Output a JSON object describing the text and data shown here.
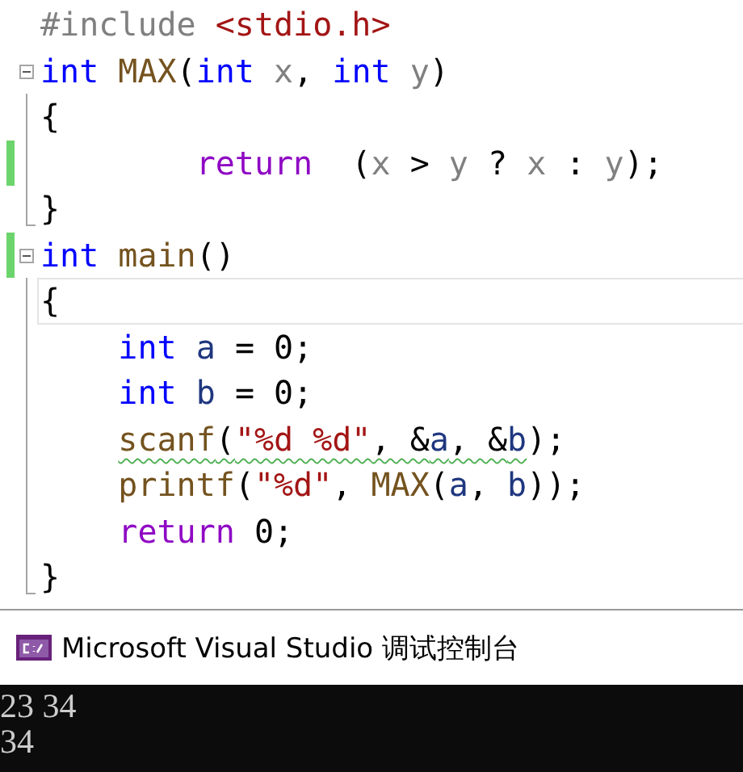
{
  "editor": {
    "lines": [
      {
        "kind": "plain",
        "changed": false,
        "current": false,
        "tokens": [
          {
            "kind": "preproc",
            "text": "#include"
          },
          {
            "kind": "string",
            "text": " <stdio.h>"
          }
        ]
      },
      {
        "kind": "fold-start",
        "changed": false,
        "current": false,
        "tokens": [
          {
            "kind": "keyword",
            "text": "int"
          },
          {
            "kind": "func",
            "text": " MAX"
          },
          {
            "kind": "text",
            "text": "("
          },
          {
            "kind": "keyword",
            "text": "int"
          },
          {
            "kind": "param",
            "text": " x"
          },
          {
            "kind": "text",
            "text": ","
          },
          {
            "kind": "keyword",
            "text": " int"
          },
          {
            "kind": "param",
            "text": " y"
          },
          {
            "kind": "text",
            "text": ")"
          }
        ]
      },
      {
        "kind": "fold-body",
        "changed": false,
        "current": false,
        "tokens": [
          {
            "kind": "text",
            "text": "{"
          }
        ]
      },
      {
        "kind": "fold-body",
        "changed": true,
        "current": false,
        "tokens": [
          {
            "kind": "control",
            "text": "        return"
          },
          {
            "kind": "text",
            "text": "  ("
          },
          {
            "kind": "param",
            "text": "x"
          },
          {
            "kind": "text",
            "text": " >"
          },
          {
            "kind": "param",
            "text": " y"
          },
          {
            "kind": "text",
            "text": " ?"
          },
          {
            "kind": "param",
            "text": " x"
          },
          {
            "kind": "text",
            "text": " :"
          },
          {
            "kind": "param",
            "text": " y"
          },
          {
            "kind": "text",
            "text": ");"
          }
        ]
      },
      {
        "kind": "fold-end",
        "changed": false,
        "current": false,
        "tokens": [
          {
            "kind": "text",
            "text": "}"
          }
        ]
      },
      {
        "kind": "fold-start",
        "changed": true,
        "current": false,
        "tokens": [
          {
            "kind": "keyword",
            "text": "int"
          },
          {
            "kind": "func",
            "text": " main"
          },
          {
            "kind": "text",
            "text": "()"
          }
        ]
      },
      {
        "kind": "fold-body",
        "changed": false,
        "current": true,
        "tokens": [
          {
            "kind": "text",
            "text": "{"
          }
        ]
      },
      {
        "kind": "fold-body",
        "changed": false,
        "current": false,
        "tokens": [
          {
            "kind": "keyword",
            "text": "    int"
          },
          {
            "kind": "local",
            "text": " a"
          },
          {
            "kind": "text",
            "text": " = 0;"
          }
        ]
      },
      {
        "kind": "fold-body",
        "changed": false,
        "current": false,
        "tokens": [
          {
            "kind": "keyword",
            "text": "    int"
          },
          {
            "kind": "local",
            "text": " b"
          },
          {
            "kind": "text",
            "text": " = 0;"
          }
        ]
      },
      {
        "kind": "fold-body",
        "changed": false,
        "current": false,
        "tokens": [
          {
            "kind": "func",
            "text": "    scanf",
            "squiggle": true
          },
          {
            "kind": "text",
            "text": "(",
            "squiggle": true
          },
          {
            "kind": "string",
            "text": "\"%d %d\"",
            "squiggle": true
          },
          {
            "kind": "text",
            "text": ", &",
            "squiggle": true
          },
          {
            "kind": "local",
            "text": "a",
            "squiggle": true
          },
          {
            "kind": "text",
            "text": ", &",
            "squiggle": true
          },
          {
            "kind": "local",
            "text": "b",
            "squiggle": true
          },
          {
            "kind": "text",
            "text": ");",
            "squiggle": false
          }
        ]
      },
      {
        "kind": "fold-body",
        "changed": false,
        "current": false,
        "tokens": [
          {
            "kind": "func",
            "text": "    printf"
          },
          {
            "kind": "text",
            "text": "("
          },
          {
            "kind": "string",
            "text": "\"%d\""
          },
          {
            "kind": "text",
            "text": ","
          },
          {
            "kind": "func",
            "text": " MAX"
          },
          {
            "kind": "text",
            "text": "("
          },
          {
            "kind": "local",
            "text": "a"
          },
          {
            "kind": "text",
            "text": ","
          },
          {
            "kind": "local",
            "text": " b"
          },
          {
            "kind": "text",
            "text": "));"
          }
        ]
      },
      {
        "kind": "fold-body",
        "changed": false,
        "current": false,
        "tokens": [
          {
            "kind": "control",
            "text": "    return"
          },
          {
            "kind": "text",
            "text": " 0;"
          }
        ]
      },
      {
        "kind": "fold-end",
        "changed": false,
        "current": false,
        "tokens": [
          {
            "kind": "text",
            "text": "}"
          }
        ]
      }
    ]
  },
  "console": {
    "title": "Microsoft Visual Studio 调试控制台",
    "output": [
      "23 34",
      "34"
    ]
  }
}
